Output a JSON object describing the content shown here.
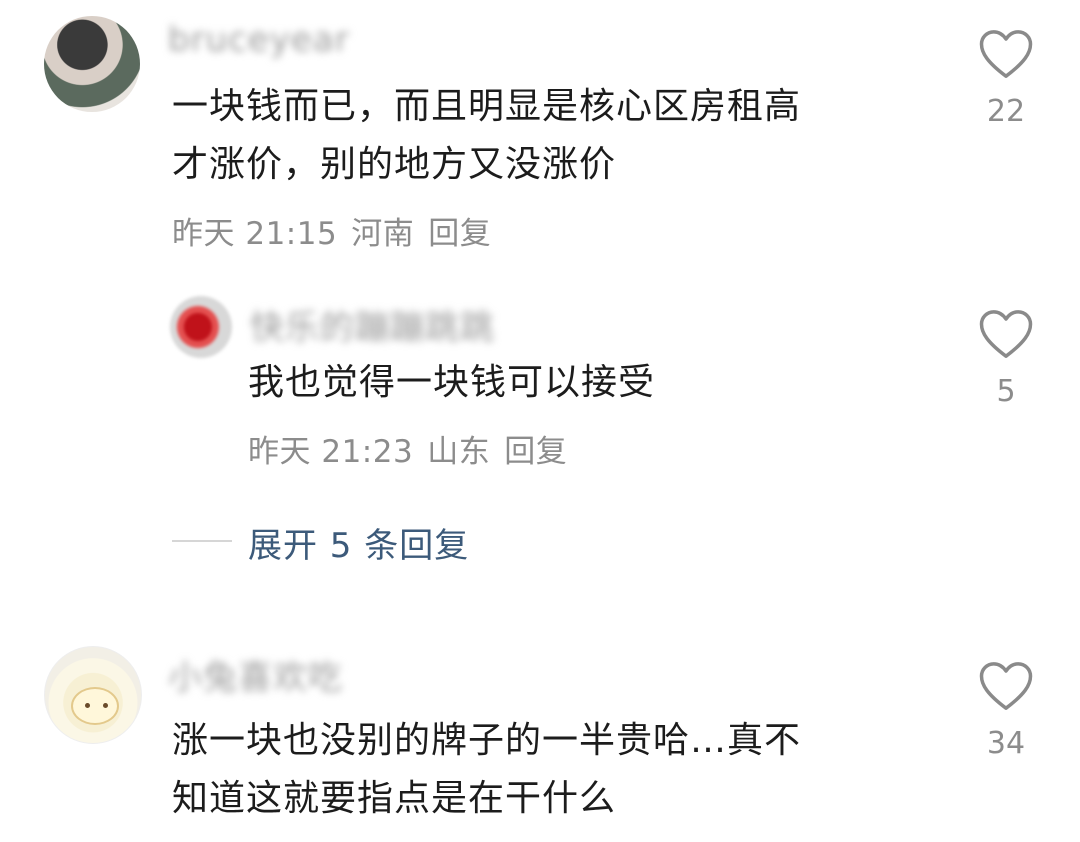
{
  "comments": [
    {
      "username": "bruceyear",
      "text_line1": "一块钱而已，而且明显是核心区房租高",
      "text_line2": "才涨价，别的地方又没涨价",
      "time": "昨天 21:15",
      "location": "河南",
      "reply": "回复",
      "likes": "22"
    },
    {
      "username": "快乐的蹦蹦跳跳",
      "text_line1": "我也觉得一块钱可以接受",
      "time": "昨天 21:23",
      "location": "山东",
      "reply": "回复",
      "likes": "5"
    },
    {
      "username": "小兔喜欢吃",
      "text_line1": "涨一块也没别的牌子的一半贵哈…真不",
      "text_line2": "知道这就要指点是在干什么",
      "likes": "34"
    }
  ],
  "expand_replies": "展开 5 条回复",
  "icons": {
    "like": "heart-outline-icon"
  },
  "colors": {
    "text": "#1c1c1c",
    "meta": "#8c8c8c",
    "link": "#3c5a7a"
  }
}
